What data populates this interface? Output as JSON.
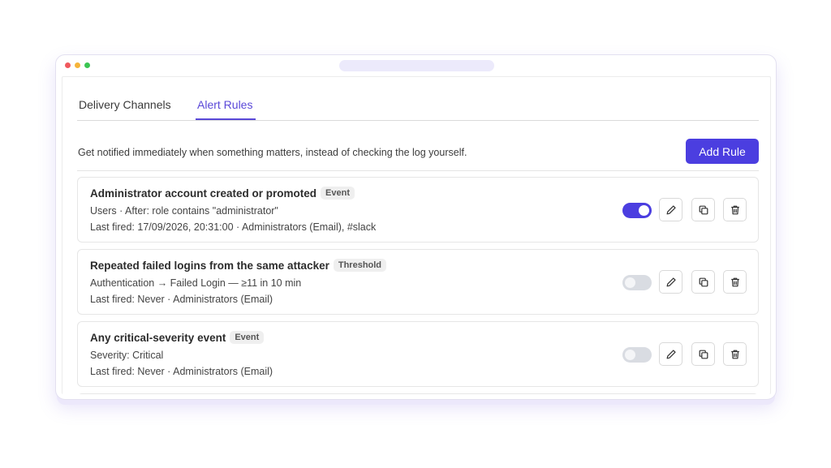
{
  "tabs": [
    {
      "label": "Delivery Channels"
    },
    {
      "label": "Alert Rules"
    }
  ],
  "active_tab": "Alert Rules",
  "description": "Get notified immediately when something matters, instead of checking the log yourself.",
  "add_button": "Add Rule",
  "accent_color": "#4b3ee0",
  "rules": [
    {
      "title": "Administrator account created or promoted",
      "badge": "Event",
      "detail": "Users · After: role contains \"administrator\"",
      "last_fired": "Last fired: 17/09/2026, 20:31:00 · Administrators (Email), #slack",
      "enabled": true
    },
    {
      "title": "Repeated failed logins from the same attacker",
      "badge": "Threshold",
      "detail": "Authentication → Failed Login — ≥11 in 10 min",
      "last_fired": "Last fired: Never · Administrators (Email)",
      "enabled": false
    },
    {
      "title": "Any critical-severity event",
      "badge": "Event",
      "detail": "Severity: Critical",
      "last_fired": "Last fired: Never · Administrators (Email)",
      "enabled": false
    }
  ],
  "icons": {
    "edit": "pencil-icon",
    "duplicate": "copy-icon",
    "delete": "trash-icon"
  }
}
